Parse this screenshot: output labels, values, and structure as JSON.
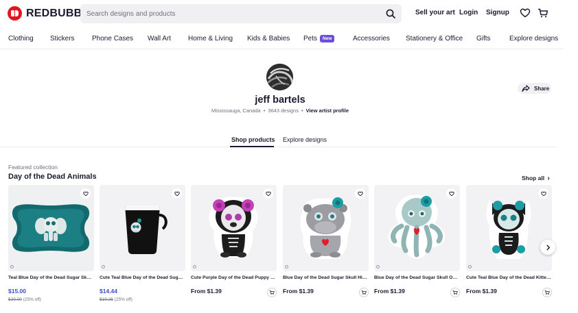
{
  "header": {
    "logo_text": "REDBUBBLE",
    "search_placeholder": "Search designs and products",
    "sell_label": "Sell your art",
    "login_label": "Login",
    "signup_label": "Signup",
    "icons": [
      "search-icon",
      "heart-icon",
      "cart-icon"
    ]
  },
  "nav": {
    "items": [
      {
        "label": "Clothing"
      },
      {
        "label": "Stickers"
      },
      {
        "label": "Phone Cases"
      },
      {
        "label": "Wall Art"
      },
      {
        "label": "Home & Living"
      },
      {
        "label": "Kids & Babies"
      },
      {
        "label": "Pets",
        "badge": "New"
      },
      {
        "label": "Accessories"
      },
      {
        "label": "Stationery & Office"
      },
      {
        "label": "Gifts"
      },
      {
        "label": "Explore designs"
      }
    ]
  },
  "artist": {
    "name": "jeff bartels",
    "location": "Mississauga, Canada",
    "designs": "3643 designs",
    "profile_link": "View artist profile",
    "share_label": "Share"
  },
  "tabs": {
    "shop": "Shop products",
    "explore": "Explore designs",
    "active": "shop"
  },
  "collection": {
    "featured_label": "Featured collection",
    "title": "Day of the Dead Animals",
    "shop_all_label": "Shop all",
    "products": [
      {
        "title": "Teal Blue Day of the Dead Sugar Skull Baby Elephant",
        "price": "$15.00",
        "old_price": "$20.00",
        "discount": "(25% off)",
        "product": "pet-bowl-mat"
      },
      {
        "title": "Cute Teal Blue Day of the Dead Sugar Skull Mug",
        "price": "$14.44",
        "old_price": "$19.26",
        "discount": "(25% off)",
        "product": "latte-mug"
      },
      {
        "title": "Cute Purple Day of the Dead Puppy Dog Sticker",
        "price": "From $1.39",
        "product": "puppy-sticker"
      },
      {
        "title": "Blue Day of the Dead Sugar Skull Hippo Sticker",
        "price": "From $1.39",
        "product": "hippo-sticker"
      },
      {
        "title": "Blue Day of the Dead Sugar Skull Octopus Sticker",
        "price": "From $1.39",
        "product": "octopus-sticker"
      },
      {
        "title": "Cute Teal Blue Day of the Dead Kitten Cat Sticker",
        "price": "From $1.39",
        "product": "kitten-sticker"
      }
    ]
  },
  "colors": {
    "brand_red": "#e41321",
    "sale_price": "#3b4fc4",
    "new_badge": "#6b4fd8",
    "teal": "#1a8a8a",
    "magenta": "#c43fb8"
  }
}
